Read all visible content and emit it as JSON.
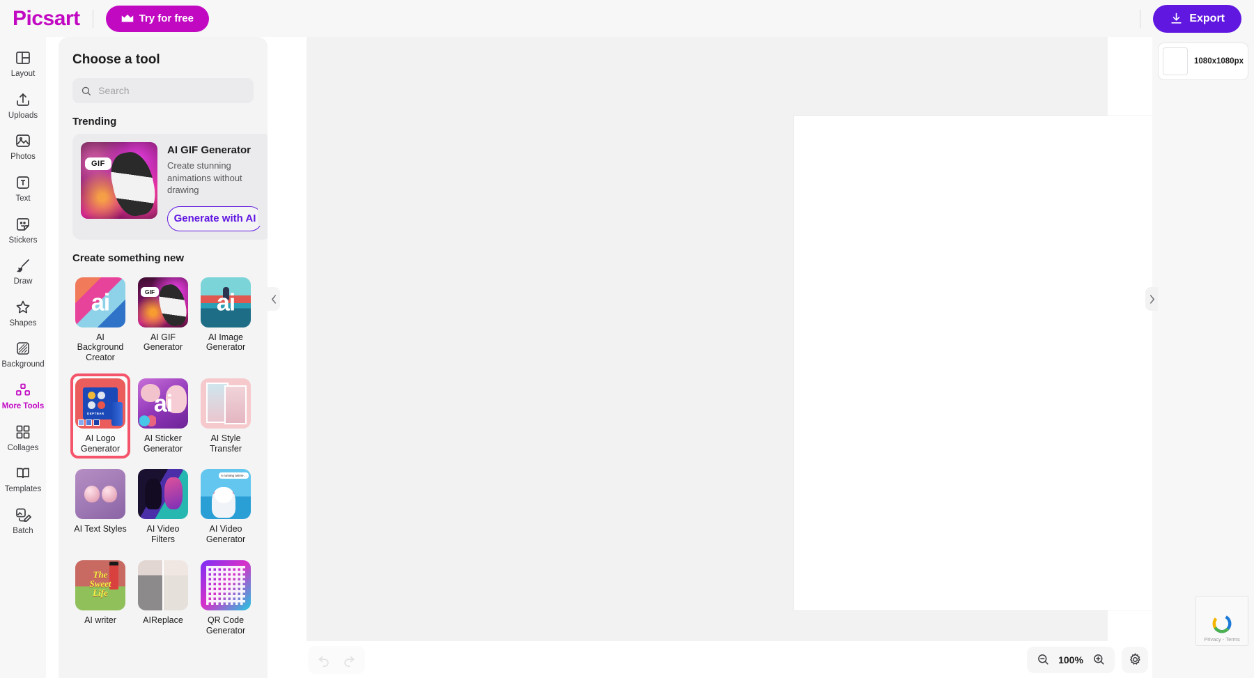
{
  "topbar": {
    "brand": "Picsart",
    "try_label": "Try for free",
    "export_label": "Export"
  },
  "sidebar": {
    "items": [
      {
        "label": "Layout",
        "icon": "layout-icon",
        "active": false
      },
      {
        "label": "Uploads",
        "icon": "upload-icon",
        "active": false
      },
      {
        "label": "Photos",
        "icon": "photo-icon",
        "active": false
      },
      {
        "label": "Text",
        "icon": "text-icon",
        "active": false
      },
      {
        "label": "Stickers",
        "icon": "sticker-icon",
        "active": false
      },
      {
        "label": "Draw",
        "icon": "brush-icon",
        "active": false
      },
      {
        "label": "Shapes",
        "icon": "star-icon",
        "active": false
      },
      {
        "label": "Background",
        "icon": "background-icon",
        "active": false
      },
      {
        "label": "More Tools",
        "icon": "grid-three-icon",
        "active": true
      },
      {
        "label": "Collages",
        "icon": "grid-four-icon",
        "active": false
      },
      {
        "label": "Templates",
        "icon": "book-icon",
        "active": false
      },
      {
        "label": "Batch",
        "icon": "batch-edit-icon",
        "active": false
      }
    ]
  },
  "panel": {
    "title": "Choose a tool",
    "search_placeholder": "Search",
    "search_value": "",
    "trending_heading": "Trending",
    "trending": {
      "badge": "GIF",
      "title": "AI GIF Generator",
      "description": "Create stunning animations without drawing",
      "cta": "Generate with AI"
    },
    "create_heading": "Create something new",
    "tools": [
      {
        "label": "AI Background Creator",
        "thumb": "t-bgc",
        "selected": false
      },
      {
        "label": "AI GIF Generator",
        "thumb": "t-gif",
        "selected": false
      },
      {
        "label": "AI Image Generator",
        "thumb": "t-img",
        "selected": false
      },
      {
        "label": "AI Logo Generator",
        "thumb": "t-logo",
        "selected": true
      },
      {
        "label": "AI Sticker Generator",
        "thumb": "t-stick",
        "selected": false
      },
      {
        "label": "AI Style Transfer",
        "thumb": "t-style",
        "selected": false
      },
      {
        "label": "AI Text Styles",
        "thumb": "t-text",
        "selected": false
      },
      {
        "label": "AI Video Filters",
        "thumb": "t-vf",
        "selected": false
      },
      {
        "label": "AI Video Generator",
        "thumb": "t-vg",
        "selected": false
      },
      {
        "label": "AI writer",
        "thumb": "t-writer",
        "selected": false
      },
      {
        "label": "AIReplace",
        "thumb": "t-rep",
        "selected": false
      },
      {
        "label": "QR Code Generator",
        "thumb": "t-qr",
        "selected": false
      }
    ]
  },
  "right_panel": {
    "page_size": "1080x1080px"
  },
  "bottombar": {
    "zoom_level": "100%"
  },
  "recaptcha": {
    "privacy": "Privacy",
    "separator": " - ",
    "terms": "Terms"
  },
  "colors": {
    "brand_magenta": "#c209c2",
    "export_purple": "#6017e0",
    "selection_red": "#f4556a",
    "panel_bg": "#f4f4f5"
  }
}
